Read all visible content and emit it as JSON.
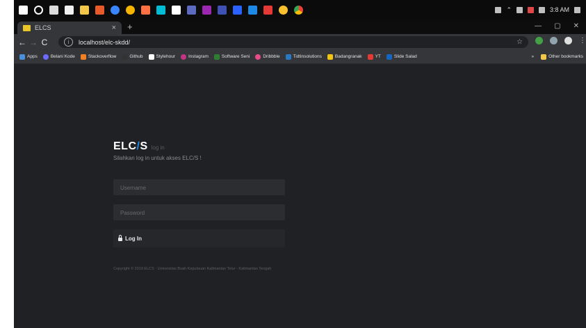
{
  "taskbar": {
    "icons": [
      "start-icon",
      "search-icon",
      "task-view-icon",
      "store-icon",
      "folder-icon",
      "app-icon-1",
      "app-icon-2",
      "app-icon-3",
      "app-icon-4",
      "app-icon-5",
      "app-icon-6",
      "app-icon-7",
      "app-icon-8",
      "app-icon-9",
      "app-icon-10",
      "app-icon-11",
      "app-icon-12",
      "chrome-icon"
    ],
    "time": "3:8 AM"
  },
  "browser": {
    "tab_title": "ELCS",
    "address": "localhost/elc-skdd/",
    "window_controls": [
      "—",
      "▢",
      "✕"
    ]
  },
  "bookmarks": {
    "items": [
      {
        "label": "Apps",
        "color": "#4a90d9"
      },
      {
        "label": "Belani Kode",
        "color": "#6b6bff"
      },
      {
        "label": "Stackoverflow",
        "color": "#f48024"
      },
      {
        "label": "Github",
        "color": "#333333"
      },
      {
        "label": "Stylehour",
        "color": "#222222"
      },
      {
        "label": "Instagram",
        "color": "#c13584"
      },
      {
        "label": "Software Seni",
        "color": "#2e7d32"
      },
      {
        "label": "Dribbble",
        "color": "#ea4c89"
      },
      {
        "label": "Tidtinsolutions",
        "color": "#2a78c2"
      },
      {
        "label": "Badangranak",
        "color": "#f1c40f"
      },
      {
        "label": "YT",
        "color": "#e53935"
      },
      {
        "label": "Slide Salad",
        "color": "#1565c0"
      }
    ],
    "more": "»",
    "other": "Other bookmarks"
  },
  "login": {
    "brand_main": "ELC",
    "brand_slash": "/",
    "brand_tail": "S",
    "brand_small": "log in",
    "subtitle": "Silahkan log in untuk akses ELC/S !",
    "username_placeholder": "Username",
    "password_placeholder": "Password",
    "button_label": "Log In",
    "copyright": "Copyright © 2019 ELCS · Universitas Buah Kepulauan Kalimantan Telur - Kalimantan Tengah"
  },
  "colors": {
    "page_bg": "#202124",
    "accent": "#1e88e5"
  }
}
